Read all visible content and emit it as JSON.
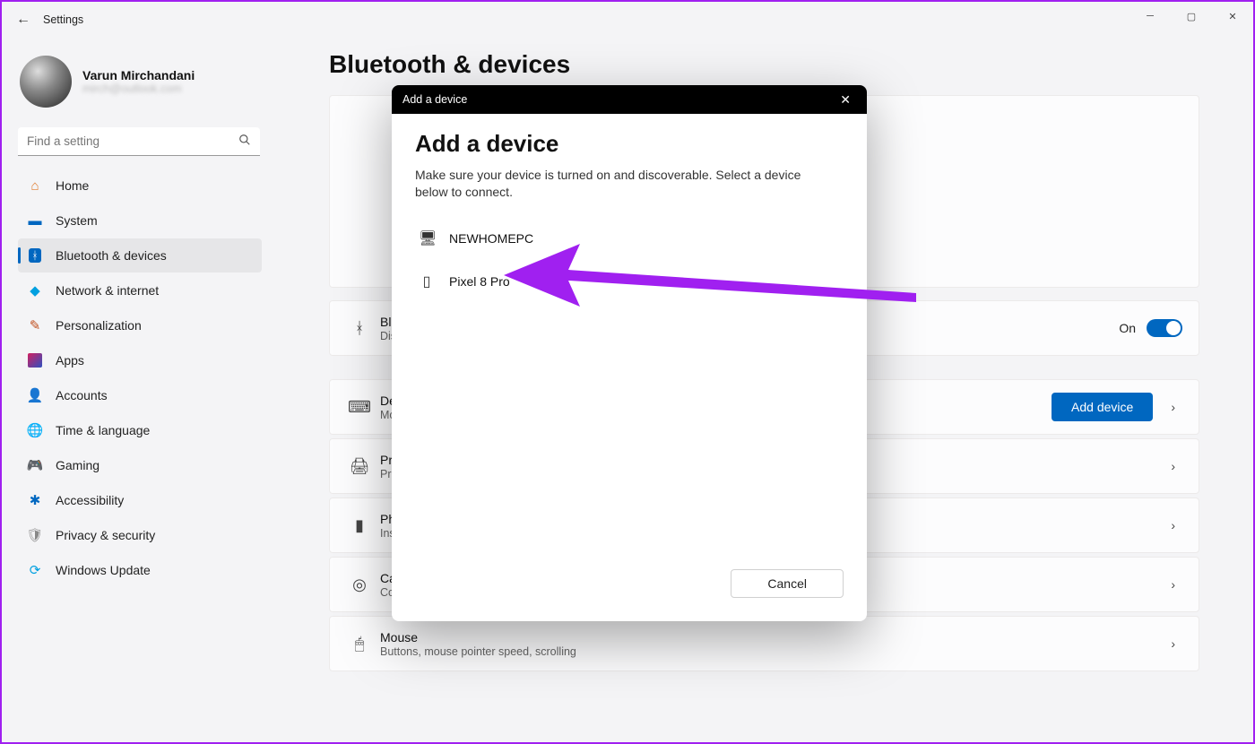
{
  "window": {
    "title": "Settings"
  },
  "profile": {
    "name": "Varun Mirchandani",
    "email": "mirch@outlook.com"
  },
  "search": {
    "placeholder": "Find a setting"
  },
  "nav": {
    "items": [
      {
        "label": "Home"
      },
      {
        "label": "System"
      },
      {
        "label": "Bluetooth & devices"
      },
      {
        "label": "Network & internet"
      },
      {
        "label": "Personalization"
      },
      {
        "label": "Apps"
      },
      {
        "label": "Accounts"
      },
      {
        "label": "Time & language"
      },
      {
        "label": "Gaming"
      },
      {
        "label": "Accessibility"
      },
      {
        "label": "Privacy & security"
      },
      {
        "label": "Windows Update"
      }
    ]
  },
  "page": {
    "title": "Bluetooth & devices"
  },
  "cards": {
    "bluetooth": {
      "title": "Blu",
      "sub": "Dis",
      "state": "On"
    },
    "devices": {
      "title": "De",
      "sub": "Mo",
      "button": "Add device"
    },
    "printers": {
      "title": "Pri",
      "sub": "Pre"
    },
    "phone": {
      "title": "Ph",
      "sub": "Ins"
    },
    "cameras": {
      "title": "Cameras",
      "sub": "Connected cameras, default image settings"
    },
    "mouse": {
      "title": "Mouse",
      "sub": "Buttons, mouse pointer speed, scrolling"
    }
  },
  "dialog": {
    "winTitle": "Add a device",
    "heading": "Add a device",
    "desc": "Make sure your device is turned on and discoverable. Select a device below to connect.",
    "devices": [
      {
        "name": "NEWHOMEPC"
      },
      {
        "name": "Pixel 8 Pro"
      }
    ],
    "cancel": "Cancel"
  }
}
